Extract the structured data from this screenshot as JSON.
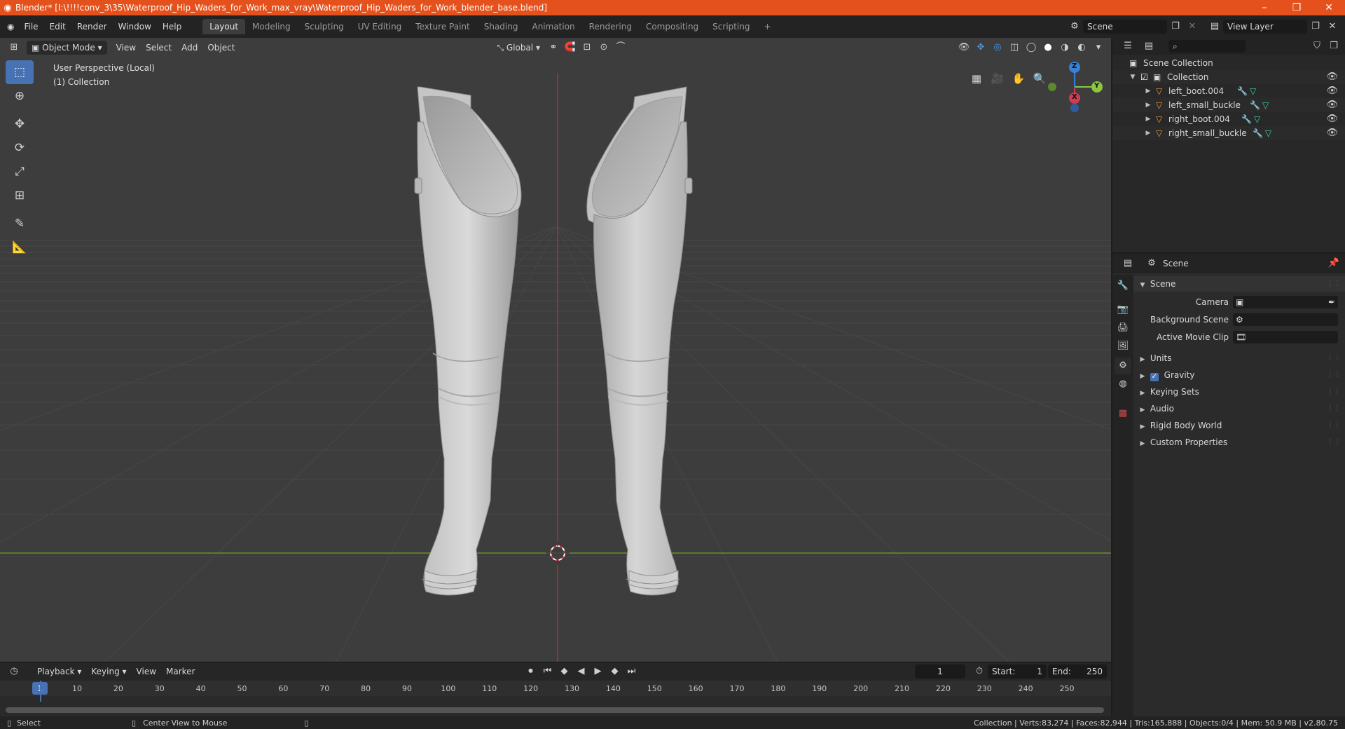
{
  "window": {
    "title": "Blender* [I:\\!!!!conv_3\\35\\Waterproof_Hip_Waders_for_Work_max_vray\\Waterproof_Hip_Waders_for_Work_blender_base.blend]",
    "minimize_glyph": "–",
    "restore_glyph": "❐",
    "close_glyph": "✕"
  },
  "menus": [
    "File",
    "Edit",
    "Render",
    "Window",
    "Help"
  ],
  "workspaces": [
    {
      "label": "Layout",
      "active": true
    },
    {
      "label": "Modeling"
    },
    {
      "label": "Sculpting"
    },
    {
      "label": "UV Editing"
    },
    {
      "label": "Texture Paint"
    },
    {
      "label": "Shading"
    },
    {
      "label": "Animation"
    },
    {
      "label": "Rendering"
    },
    {
      "label": "Compositing"
    },
    {
      "label": "Scripting"
    }
  ],
  "scene_selector": {
    "value": "Scene"
  },
  "view_layer_selector": {
    "value": "View Layer"
  },
  "viewport_header": {
    "mode": "Object Mode",
    "menus": [
      "View",
      "Select",
      "Add",
      "Object"
    ],
    "transform_orientation": "Global"
  },
  "viewport": {
    "perspective_label": "User Perspective (Local)",
    "collection_label": "(1) Collection",
    "gizmo": {
      "z": "Z",
      "y": "Y",
      "x": "X"
    }
  },
  "timeline": {
    "menus": [
      "Playback",
      "Keying",
      "View",
      "Marker"
    ],
    "current_frame": "1",
    "start_label": "Start:",
    "start_value": "1",
    "end_label": "End:",
    "end_value": "250",
    "ticks": [
      "1",
      "10",
      "20",
      "30",
      "40",
      "50",
      "60",
      "70",
      "80",
      "90",
      "100",
      "110",
      "120",
      "130",
      "140",
      "150",
      "160",
      "170",
      "180",
      "190",
      "200",
      "210",
      "220",
      "230",
      "240",
      "250"
    ]
  },
  "statusbar": {
    "select": "Select",
    "center_view": "Center View to Mouse",
    "stats": "Collection | Verts:83,274 | Faces:82,944 | Tris:165,888 | Objects:0/4 | Mem: 50.9 MB | v2.80.75"
  },
  "outliner": {
    "root": "Scene Collection",
    "collection": "Collection",
    "objects": [
      "left_boot.004",
      "left_small_buckle",
      "right_boot.004",
      "right_small_buckle"
    ]
  },
  "properties": {
    "header": "Scene",
    "panel_title": "Scene",
    "camera_label": "Camera",
    "background_scene_label": "Background Scene",
    "active_movie_clip_label": "Active Movie Clip",
    "sections": [
      "Units",
      "Gravity",
      "Keying Sets",
      "Audio",
      "Rigid Body World",
      "Custom Properties"
    ]
  },
  "colors": {
    "titlebar": "#e5511c",
    "accent": "#4772b3",
    "x_axis": "#d43a4f",
    "y_axis": "#8cc63f",
    "z_axis": "#3a80d6",
    "object_icon": "#e8923a"
  }
}
